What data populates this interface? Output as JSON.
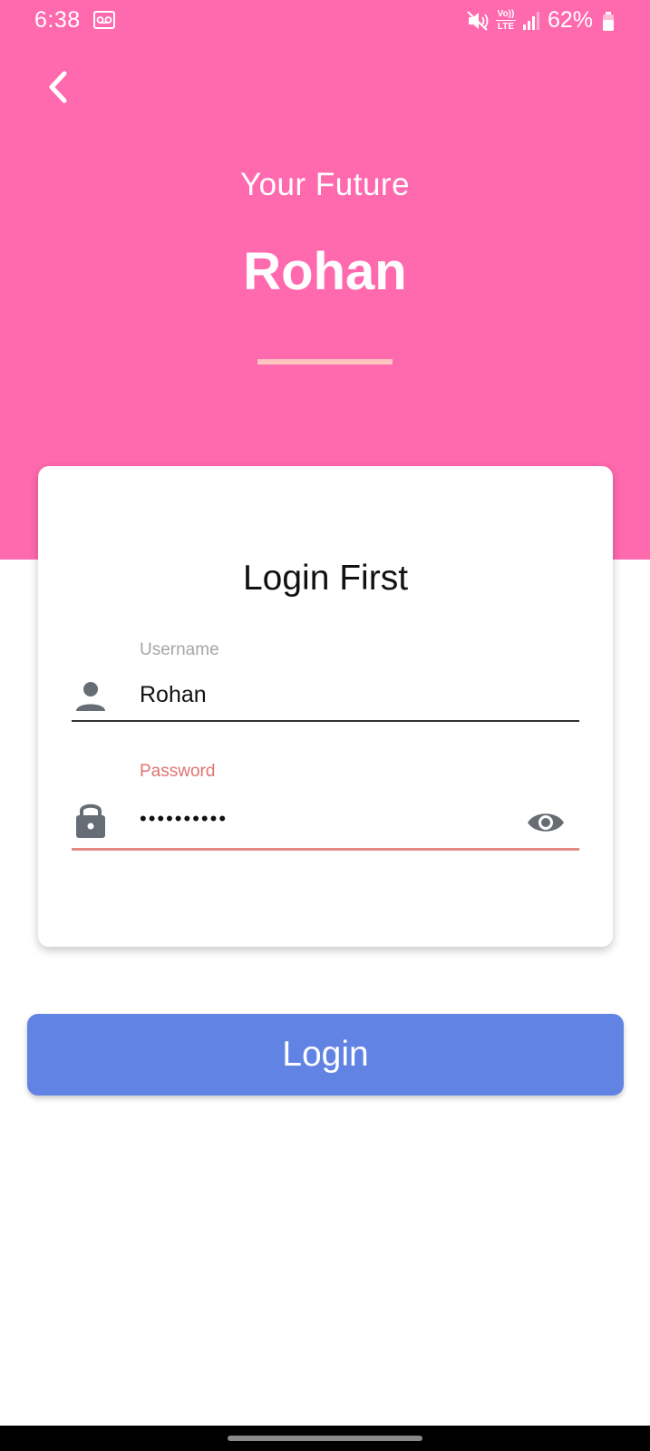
{
  "status_bar": {
    "time": "6:38",
    "battery": "62%",
    "volte_top": "Vo))",
    "volte_bottom": "LTE",
    "icons": [
      "voicemail-icon",
      "mute-icon",
      "volte-icon",
      "signal-icon",
      "battery-icon"
    ]
  },
  "header": {
    "back_icon": "chevron-left-icon",
    "subtitle": "Your Future",
    "name": "Rohan"
  },
  "card": {
    "title": "Login First",
    "username": {
      "label": "Username",
      "value": "Rohan",
      "icon": "person-icon"
    },
    "password": {
      "label": "Password",
      "value": "••••••••••",
      "icon": "lock-icon",
      "toggle_icon": "eye-icon"
    }
  },
  "login_button": {
    "label": "Login"
  },
  "colors": {
    "header": "#ff69ae",
    "divider": "#ffc3c0",
    "button": "#6183e3",
    "active_field": "#e48a84",
    "icon_gray": "#666d75"
  }
}
